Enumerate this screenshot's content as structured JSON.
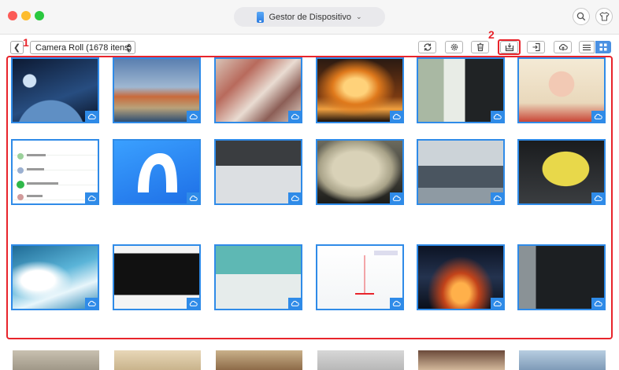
{
  "window": {
    "device_title": "Gestor de Dispositivo"
  },
  "toolbar": {
    "album_label": "Camera Roll (1678 itens)",
    "step1": "1",
    "step2": "2"
  },
  "icons": {
    "refresh": "refresh-icon",
    "settings": "gear-icon",
    "delete": "trash-icon",
    "export": "export-to-computer-icon",
    "import": "import-icon",
    "upload": "cloud-upload-icon",
    "list": "list-view-icon",
    "grid": "grid-view-icon"
  },
  "colors": {
    "accent": "#2f8be8",
    "highlight": "#e8242b"
  },
  "photos": [
    {
      "theme": "space-planet"
    },
    {
      "theme": "city-tower"
    },
    {
      "theme": "fabric"
    },
    {
      "theme": "sunset-bottle"
    },
    {
      "theme": "keyboard-desk"
    },
    {
      "theme": "pig-poster"
    },
    {
      "theme": "chat-screenshot"
    },
    {
      "theme": "airmore-logo"
    },
    {
      "theme": "keyboard-usb"
    },
    {
      "theme": "leather-bag"
    },
    {
      "theme": "office"
    },
    {
      "theme": "yellow-cloth"
    },
    {
      "theme": "wave-surfer"
    },
    {
      "theme": "tablet"
    },
    {
      "theme": "teal-hand"
    },
    {
      "theme": "document"
    },
    {
      "theme": "robot-fire"
    },
    {
      "theme": "dark-room"
    }
  ]
}
